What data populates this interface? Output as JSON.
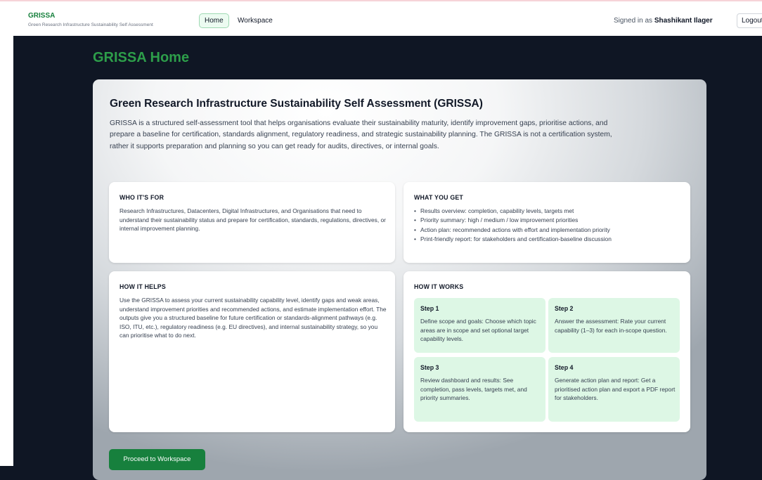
{
  "header": {
    "brand_title": "GRISSA",
    "brand_subtitle": "Green Research Infrastructure Sustainability Self Assessment",
    "nav_home": "Home",
    "nav_workspace": "Workspace",
    "signed_in_prefix": "Signed in as",
    "user_name": "Shashikant Ilager",
    "logout": "Logout"
  },
  "page": {
    "title": "GRISSA Home"
  },
  "intro": {
    "heading": "Green Research Infrastructure Sustainability Self Assessment (GRISSA)",
    "paragraph": "GRISSA is a structured self-assessment tool that helps organisations evaluate their sustainability maturity, identify improvement gaps, prioritise actions, and prepare a baseline for certification, standards alignment, regulatory readiness, and strategic sustainability planning. The GRISSA is not a certification system, rather it supports preparation and planning so you can get ready for audits, directives, or internal goals."
  },
  "who": {
    "heading": "WHO IT'S FOR",
    "text": "Research Infrastructures, Datacenters, Digital Infrastructures, and Organisations that need to understand their sustainability status and prepare for certification, standards, regulations, directives, or internal improvement planning."
  },
  "what": {
    "heading": "WHAT YOU GET",
    "items": [
      "Results overview: completion, capability levels, targets met",
      "Priority summary: high / medium / low improvement priorities",
      "Action plan: recommended actions with effort and implementation priority",
      "Print-friendly report: for stakeholders and certification-baseline discussion"
    ]
  },
  "helps": {
    "heading": "HOW IT HELPS",
    "text": "Use the GRISSA to assess your current sustainability capability level, identify gaps and weak areas, understand improvement priorities and recommended actions, and estimate implementation effort. The outputs give you a structured baseline for future certification or standards-alignment pathways (e.g. ISO, ITU, etc.), regulatory readiness (e.g. EU directives), and internal sustainability strategy, so you can prioritise what to do next."
  },
  "works": {
    "heading": "HOW IT WORKS",
    "steps": [
      {
        "title": "Step 1",
        "text": "Define scope and goals: Choose which topic areas are in scope and set optional target capability levels."
      },
      {
        "title": "Step 2",
        "text": "Answer the assessment: Rate your current capability (1–3) for each in-scope question."
      },
      {
        "title": "Step 3",
        "text": "Review dashboard and results: See completion, pass levels, targets met, and priority summaries."
      },
      {
        "title": "Step 4",
        "text": "Generate action plan and report: Get a prioritised action plan and export a PDF report for stakeholders."
      }
    ]
  },
  "cta": {
    "label": "Proceed to Workspace"
  },
  "colors": {
    "brand_green": "#17803d",
    "title_green": "#2d9e4a",
    "step_bg": "#ddf7e5",
    "background_dark": "#0f1624"
  }
}
